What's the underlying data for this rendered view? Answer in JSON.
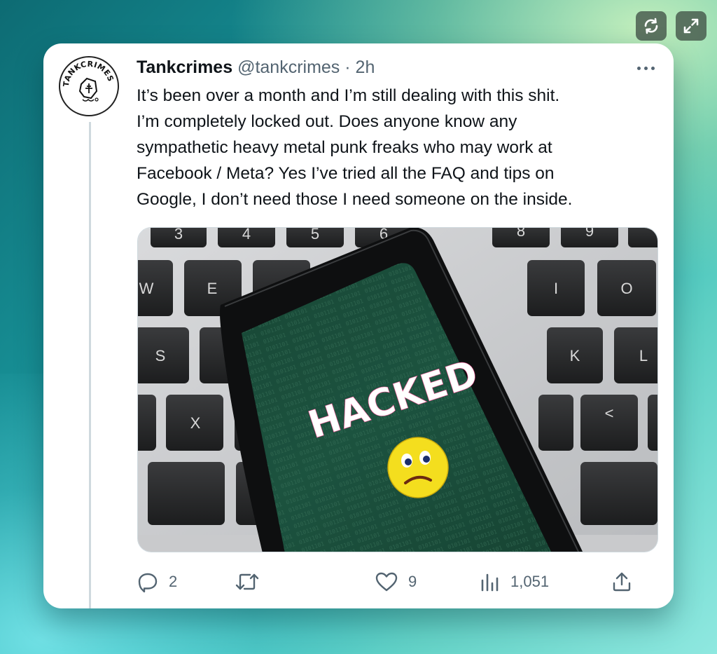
{
  "window_controls": {
    "refresh_icon": "refresh-icon",
    "expand_icon": "expand-icon"
  },
  "tweet": {
    "display_name": "Tankcrimes",
    "handle": "@tankcrimes",
    "separator": "·",
    "time": "2h",
    "text": "It’s been over a month and I’m still dealing with this shit.\nI’m completely locked out. Does anyone know any\nsympathetic heavy metal punk freaks who may work at\nFacebook / Meta? Yes I’ve tried all the FAQ and tips on\nGoogle, I don’t need those I need someone on the inside.",
    "avatar": {
      "text": "TANKCRIMES"
    },
    "media": {
      "screen_text": "HACKED",
      "keys": {
        "top_row": [
          "3",
          "4",
          "5",
          "6",
          "8",
          "9"
        ],
        "w": "W",
        "e": "E",
        "i": "I",
        "o": "O",
        "s": "S",
        "k": "K",
        "l": "L",
        "x": "X",
        "lt": "<"
      }
    },
    "actions": {
      "replies": "2",
      "retweets": "",
      "likes": "9",
      "views": "1,051"
    }
  },
  "colors": {
    "text_primary": "#0f1419",
    "text_secondary": "#536471",
    "phone_screen": "#1f5a45"
  }
}
